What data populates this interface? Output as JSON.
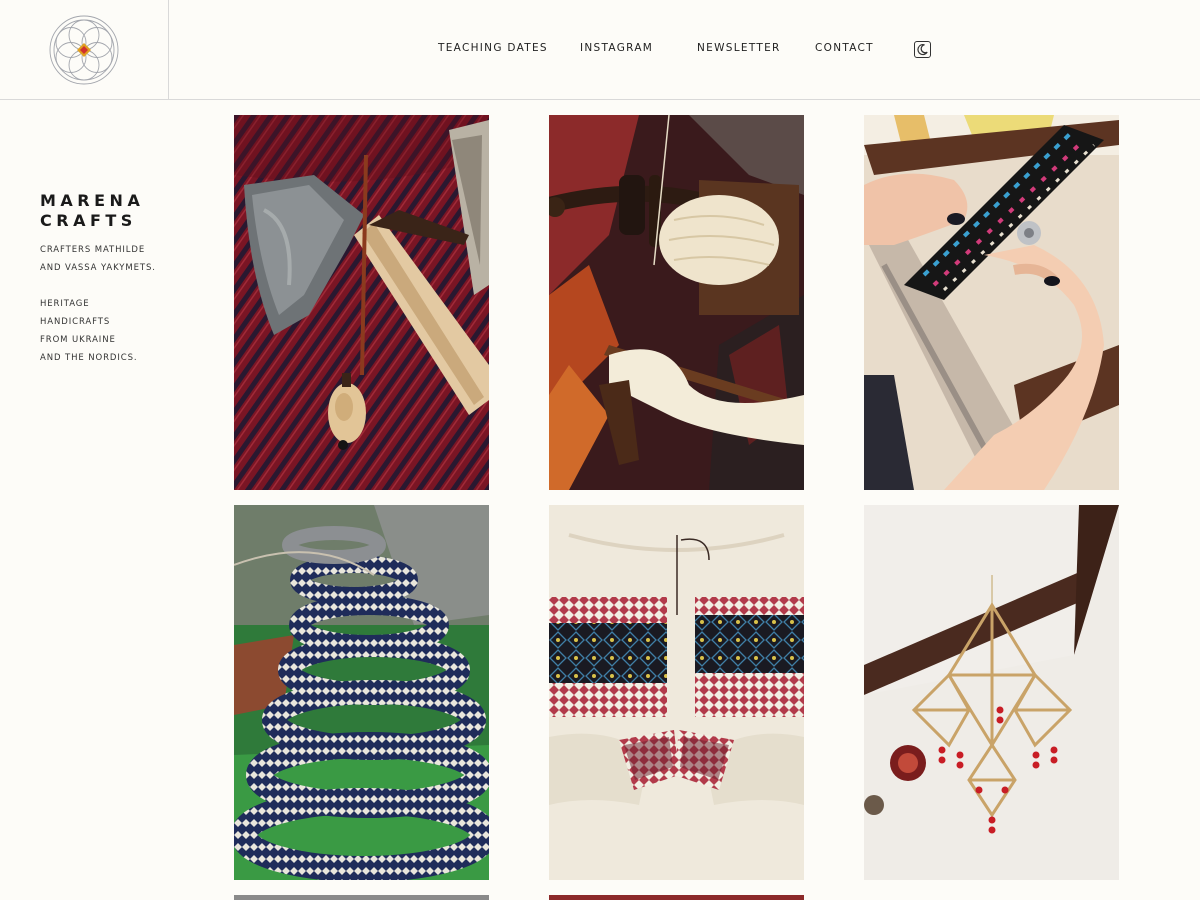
{
  "brand": {
    "title_line1": "MARENA",
    "title_line2": "CRAFTS",
    "tagline": "CRAFTERS MATHILDE AND VASSA YAKYMETS.",
    "description": "HERITAGE HANDICRAFTS FROM UKRAINE AND THE NORDICS."
  },
  "nav": {
    "items": [
      {
        "label": "TEACHING DATES"
      },
      {
        "label": "INSTAGRAM"
      },
      {
        "label": "NEWSLETTER"
      },
      {
        "label": "CONTACT"
      }
    ],
    "theme_toggle_icon": "moon-icon"
  },
  "gallery": {
    "tiles": [
      {
        "subject": "axe, awl and netting needle on red striped woven fabric"
      },
      {
        "subject": "spindle with cream wool thread over a red rug"
      },
      {
        "subject": "hands beading a colorful beaded strap on a frame loom"
      },
      {
        "subject": "coiled blue and white woven band on green cloth"
      },
      {
        "subject": "embroidered linen shirt with red and black cross-stitch"
      },
      {
        "subject": "hanging straw pavuk ornament with red beads"
      },
      {
        "subject": "partially visible photo"
      },
      {
        "subject": "partially visible photo"
      }
    ]
  },
  "colors": {
    "background": "#fdfcf8",
    "divider": "#d9d9d9",
    "text": "#1e1e1e",
    "logo_accent_red": "#d0312d",
    "logo_accent_gold": "#e0a020"
  }
}
